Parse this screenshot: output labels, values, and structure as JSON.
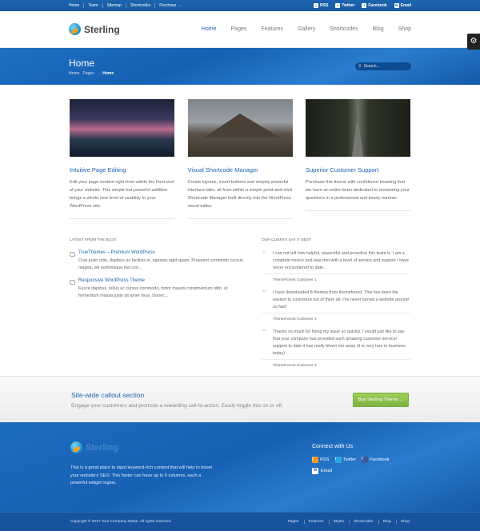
{
  "topbar": {
    "links": [
      "Home",
      "Team",
      "Sitemap",
      "Shortcodes",
      "Purchase →"
    ],
    "social": [
      {
        "label": "RSS",
        "icon": "rss-icon"
      },
      {
        "label": "Twitter",
        "icon": "twitter-icon"
      },
      {
        "label": "Facebook",
        "icon": "facebook-icon"
      },
      {
        "label": "Email",
        "icon": "email-icon"
      }
    ]
  },
  "header": {
    "logo_text": "Sterling",
    "nav": [
      "Home",
      "Pages",
      "Features",
      "Gallery",
      "Shortcodes",
      "Blog",
      "Shop"
    ],
    "active_nav": "Home"
  },
  "banner": {
    "title": "Home",
    "crumb_1": "Home",
    "crumb_2": "Pages",
    "crumb_sep": "→",
    "crumb_current": "Home",
    "search_placeholder": "Search..."
  },
  "features": [
    {
      "title": "Intuitive Page Editing",
      "text": "Edit your page content right from within the front-end of your website. This simple but powerful addition brings a whole new level of usability to your WordPress site."
    },
    {
      "title": "Visual Shortcode Manager",
      "text": "Create layouts, insert buttons and employ powerful interface tabs, all from within a simple point-and-click Shortcode Manager built directly into the WordPress visual editor."
    },
    {
      "title": "Superior Customer Support",
      "text": "Purchase this theme with confidence knowing that we have an entire team dedicated to answering your questions in a professional and timely manner."
    }
  ],
  "blog": {
    "heading": "Latest from the blog",
    "posts": [
      {
        "title": "TrueThemes – Premium WordPress",
        "excerpt": "Cras justo odio, dapibus ac facilisis in, egestas eget quam. Praesent commodo cursus magna, vel scelerisque nisl con..."
      },
      {
        "title": "Responsive WordPress Theme",
        "excerpt": "Fusce dapibus, tellus ac cursus commodo, tortor mauris condimentum nibh, ut fermentum massa justo sit amet risus. Donec..."
      }
    ]
  },
  "testimonials": {
    "heading": "Our clients say it best",
    "items": [
      {
        "text": "I can not tell how helpful, respectful and proactive this team is. I am a complete novice and was met with a level of service and support I have never encountered to date...",
        "author": "ThemeForest Customer 1"
      },
      {
        "text": "I have downloaded 8 themes from themeforest. This has been the easiest to customize out of them all. I've never turned a website around so fast!",
        "author": "ThemeForest Customer 2"
      },
      {
        "text": "Thanks so much for fixing my issue so quickly. I would just like to say that your company has provided such amazing customer service/ support to date it has really blown me away (it is very rare in business today)",
        "author": "ThemeForest Customer 3"
      }
    ]
  },
  "callout": {
    "title": "Site-wide callout section",
    "text": "Engage your customers and promote a rewarding call-to-action. Easily toggle this on or off.",
    "button": "Buy Sterling Theme →"
  },
  "footer": {
    "logo_text": "Sterling",
    "text": "This is a great place to input keyword-rich content that will help to boost your website's SEO. This footer can have up to 6 columns, each a powerful widget region.",
    "connect_title": "Connect with Us",
    "social": [
      {
        "label": "RSS",
        "icon": "rss-icon",
        "color": "#f39a1e"
      },
      {
        "label": "Twitter",
        "icon": "twitter-icon",
        "color": "#2aa9e0"
      },
      {
        "label": "Facebook",
        "icon": "facebook-icon",
        "color": "#3b5998"
      }
    ],
    "email_label": "Email"
  },
  "bottombar": {
    "copyright": "Copyright © 2017 Your Company Name. All rights reserved.",
    "links": [
      "Pages",
      "Features",
      "Styles",
      "Shortcodes",
      "Blog",
      "Shop"
    ]
  },
  "colors": {
    "brand_blue": "#1c64b0",
    "cta_green": "#8bc34a"
  }
}
